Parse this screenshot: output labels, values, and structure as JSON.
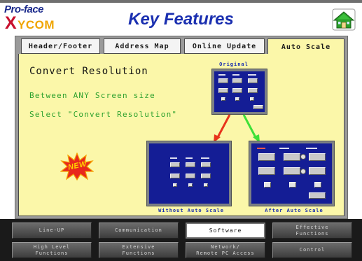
{
  "header": {
    "logo_top": "Pro-face",
    "logo_x": "X",
    "logo_bottom": "YCOM",
    "title": "Key Features",
    "home_icon": "home-icon"
  },
  "tabs": [
    {
      "label": "Header/Footer",
      "active": false
    },
    {
      "label": "Address Map",
      "active": false
    },
    {
      "label": "Online Update",
      "active": false
    },
    {
      "label": "Auto Scale",
      "active": true
    }
  ],
  "content": {
    "title": "Convert Resolution",
    "line1": "Between ANY Screen size",
    "line2": "Select \"Convert Resolution\"",
    "badge_icon": "new-starburst-icon",
    "badge_text": "NEW",
    "original_caption": "Original",
    "without_caption": "Without Auto Scale",
    "after_caption": "After Auto Scale",
    "arrow_left_color": "#e8341c",
    "arrow_right_color": "#3ee038"
  },
  "menu": {
    "row1": [
      "Line-UP",
      "Communication",
      "Software",
      "Effective\nFunctions"
    ],
    "row2": [
      "High Level\nFunctions",
      "Extensive\nFunctions",
      "Network/\nRemote PC Access",
      "Control"
    ],
    "active": "Software"
  }
}
